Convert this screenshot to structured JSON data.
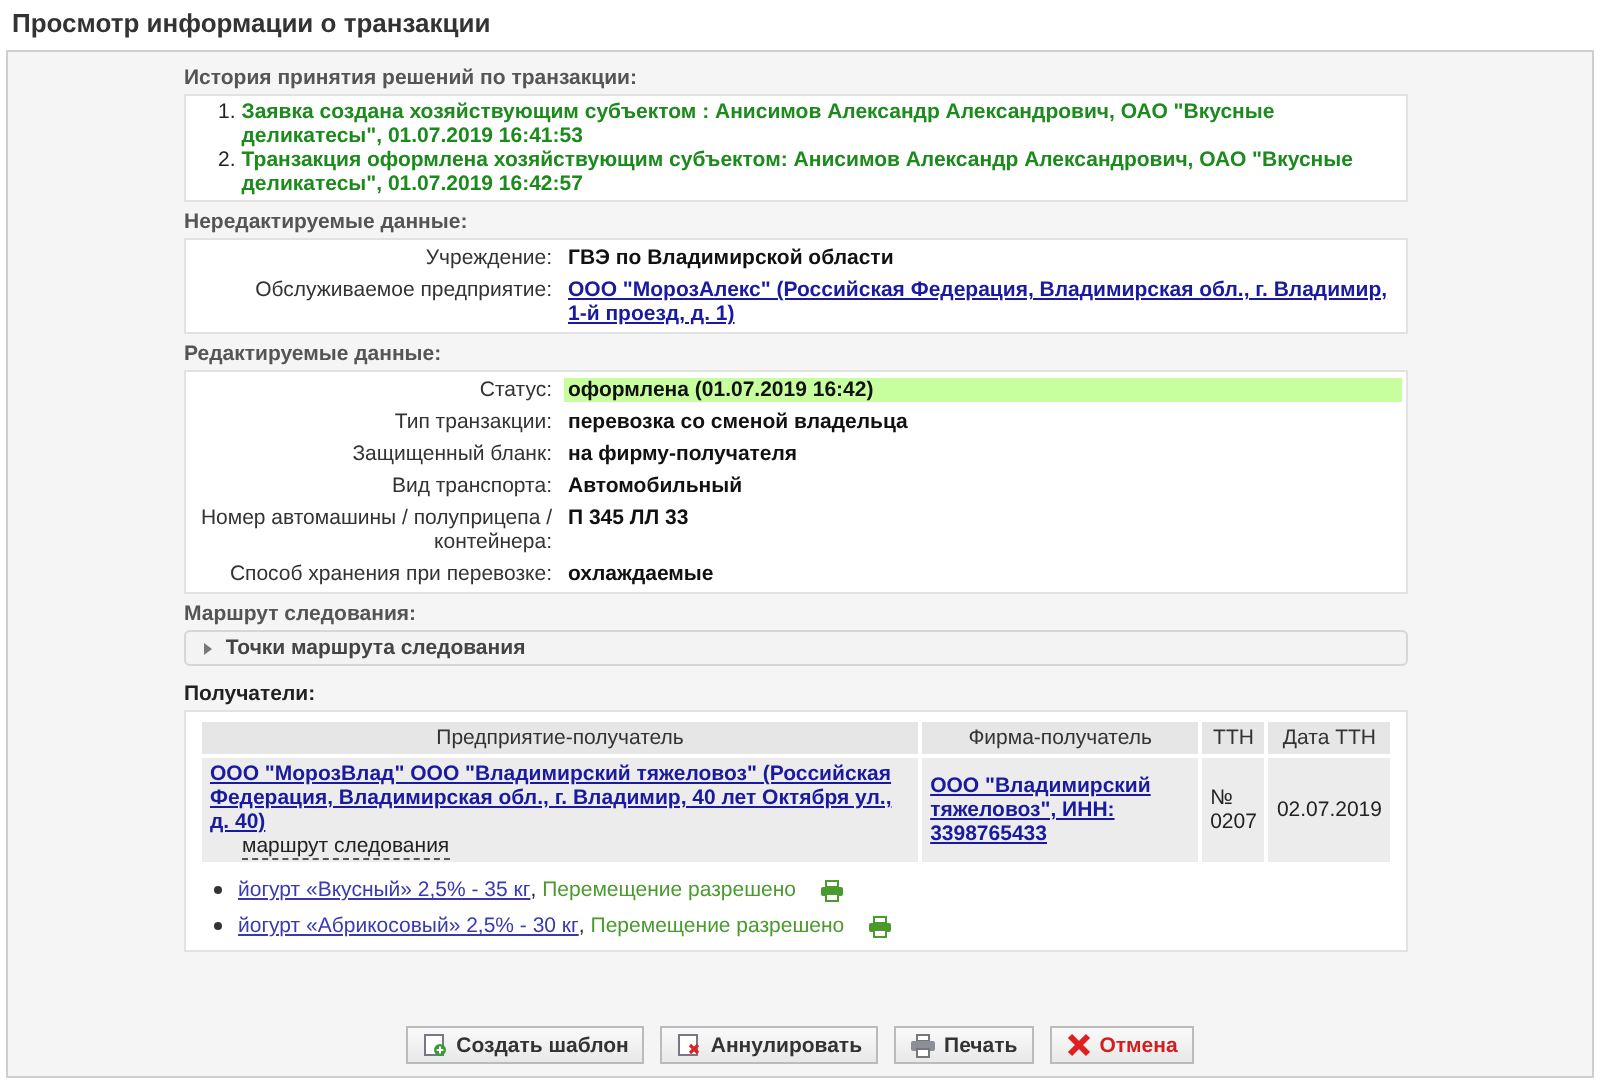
{
  "window": {
    "title": "Просмотр информации о транзакции"
  },
  "history": {
    "heading": "История принятия решений по транзакции:",
    "entries": [
      {
        "number": "1.",
        "text": "Заявка создана хозяйствующим субъектом : Анисимов Александр Александрович, ОАО \"Вкусные деликатесы\", 01.07.2019 16:41:53"
      },
      {
        "number": "2.",
        "text": "Транзакция оформлена хозяйствующим субъектом: Анисимов Александр Александрович, ОАО \"Вкусные деликатесы\", 01.07.2019 16:42:57"
      }
    ]
  },
  "fixed": {
    "heading": "Нередактируемые данные:",
    "fields": [
      {
        "label": "Учреждение:",
        "value": "ГВЭ по Владимирской области",
        "kind": "text"
      },
      {
        "label": "Обслуживаемое предприятие:",
        "value": "ООО \"МорозАлекс\" (Российская Федерация, Владимирская обл., г. Владимир, 1-й проезд, д. 1)",
        "kind": "link"
      }
    ]
  },
  "editable": {
    "heading": "Редактируемые данные:",
    "fields": [
      {
        "label": "Статус:",
        "value": "оформлена (01.07.2019 16:42)",
        "highlighted": true
      },
      {
        "label": "Тип транзакции:",
        "value": "перевозка со сменой владельца",
        "highlighted": false
      },
      {
        "label": "Защищенный бланк:",
        "value": "на фирму-получателя",
        "highlighted": false
      },
      {
        "label": "Вид транспорта:",
        "value": "Автомобильный",
        "highlighted": false
      },
      {
        "label": "Номер автомашины / полуприцепа / контейнера:",
        "value": "П 345 ЛЛ 33",
        "highlighted": false
      },
      {
        "label": "Способ хранения при перевозке:",
        "value": "охлаждаемые",
        "highlighted": false
      }
    ]
  },
  "route": {
    "heading": "Маршрут следования:",
    "toggle": {
      "label": "Точки маршрута следования",
      "expanded": false
    }
  },
  "recipients": {
    "heading": "Получатели:",
    "columns": [
      "Предприятие-получатель",
      "Фирма-получатель",
      "ТТН",
      "Дата ТТН"
    ],
    "rows": [
      {
        "enterprise": "ООО \"МорозВлад\" ООО \"Владимирский тяжеловоз\" (Российская Федерация, Владимирская обл., г. Владимир, 40 лет Октября ул., д. 40)",
        "route_link": "маршрут следования",
        "firm": "ООО \"Владимирский тяжеловоз\", ИНН: 3398765433",
        "ttn": "№ 0207",
        "ttn_date": "02.07.2019"
      }
    ],
    "products": [
      {
        "name": "йогурт «Вкусный» 2,5% - 35 кг",
        "separator": ",",
        "status": "Перемещение разрешено"
      },
      {
        "name": "йогурт «Абрикосовый» 2,5% - 30 кг",
        "separator": ",",
        "status": "Перемещение разрешено"
      }
    ]
  },
  "buttons": [
    {
      "label": "Создать шаблон",
      "kind": "template"
    },
    {
      "label": "Аннулировать",
      "kind": "cancel-doc"
    },
    {
      "label": "Печать",
      "kind": "print"
    },
    {
      "label": "Отмена",
      "kind": "close"
    }
  ]
}
